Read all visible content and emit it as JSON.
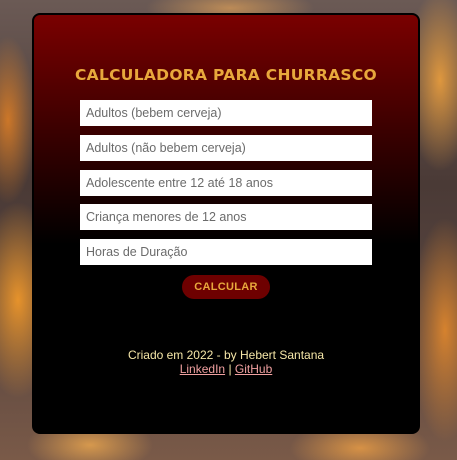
{
  "calculator": {
    "title": "CALCULADORA PARA CHURRASCO",
    "fields": [
      {
        "placeholder": "Adultos (bebem cerveja)"
      },
      {
        "placeholder": "Adultos (não bebem cerveja)"
      },
      {
        "placeholder": "Adolescente entre 12 até 18 anos"
      },
      {
        "placeholder": "Criança menores de 12 anos"
      },
      {
        "placeholder": "Horas de Duração"
      }
    ],
    "button_label": "CALCULAR"
  },
  "footer": {
    "credit": "Criado em 2022 - by Hebert Santana",
    "linkedin_label": "LinkedIn",
    "separator": "|",
    "github_label": "GitHub"
  },
  "colors": {
    "accent": "#e8a83c",
    "button_bg": "#6e0000",
    "card_top": "#7a0000",
    "card_bottom": "#000000"
  }
}
